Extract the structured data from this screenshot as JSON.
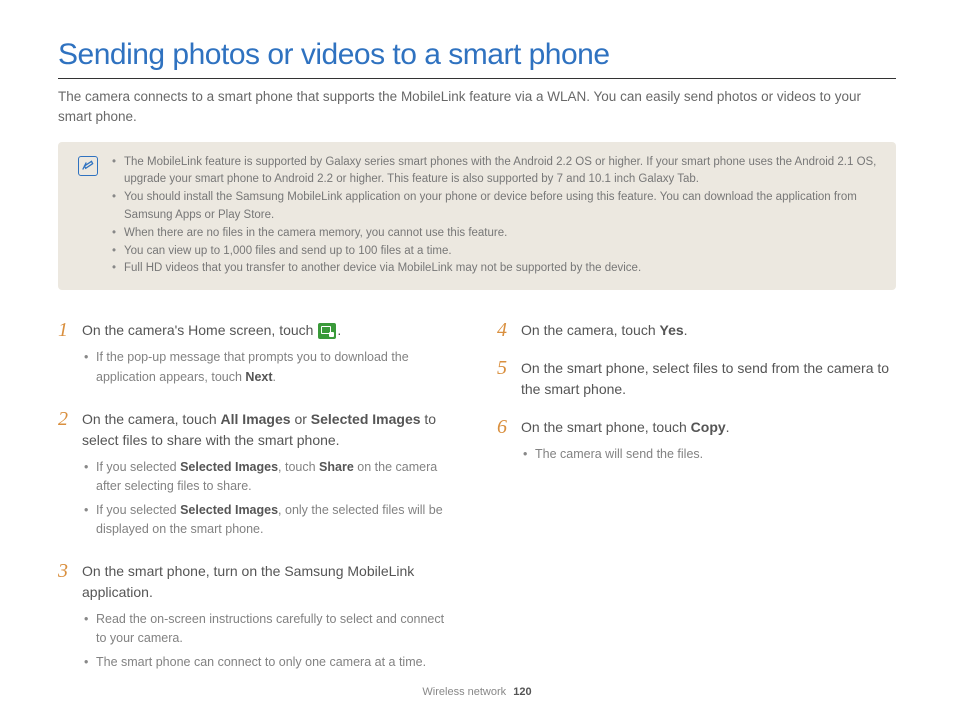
{
  "title": "Sending photos or videos to a smart phone",
  "intro": "The camera connects to a smart phone that supports the MobileLink feature via a WLAN. You can easily send photos or videos to your smart phone.",
  "notes": [
    "The MobileLink feature is supported by Galaxy series smart phones with the Android 2.2 OS or higher. If your smart phone uses the Android 2.1 OS, upgrade your smart phone to Android 2.2 or higher. This feature is also supported by 7 and 10.1 inch Galaxy Tab.",
    "You should install the Samsung MobileLink application on your phone or device before using this feature. You can download the application from Samsung Apps or Play Store.",
    "When there are no files in the camera memory, you cannot use this feature.",
    "You can view up to 1,000 files and send up to 100 files at a time.",
    "Full HD videos that you transfer to another device via MobileLink may not be supported by the device."
  ],
  "steps": {
    "s1": {
      "num": "1",
      "pre": "On the camera's Home screen, touch ",
      "post": ".",
      "sub1a": "If the pop-up message that prompts you to download the application appears, touch ",
      "sub1b": "Next",
      "sub1c": "."
    },
    "s2": {
      "num": "2",
      "a": "On the camera, touch ",
      "b": "All Images",
      "c": " or ",
      "d": "Selected Images",
      "e": " to select files to share with the smart phone.",
      "sub1a": "If you selected ",
      "sub1b": "Selected Images",
      "sub1c": ", touch ",
      "sub1d": "Share",
      "sub1e": " on the camera after selecting files to share.",
      "sub2a": "If you selected ",
      "sub2b": "Selected Images",
      "sub2c": ", only the selected files will be displayed on the smart phone."
    },
    "s3": {
      "num": "3",
      "text": "On the smart phone, turn on the Samsung MobileLink application.",
      "sub1": "Read the on-screen instructions carefully to select and connect to your camera.",
      "sub2": "The smart phone can connect to only one camera at a time."
    },
    "s4": {
      "num": "4",
      "a": "On the camera, touch ",
      "b": "Yes",
      "c": "."
    },
    "s5": {
      "num": "5",
      "text": "On the smart phone, select files to send from the camera to the smart phone."
    },
    "s6": {
      "num": "6",
      "a": "On the smart phone, touch ",
      "b": "Copy",
      "c": ".",
      "sub1": "The camera will send the files."
    }
  },
  "footer": {
    "section": "Wireless network",
    "page": "120"
  }
}
